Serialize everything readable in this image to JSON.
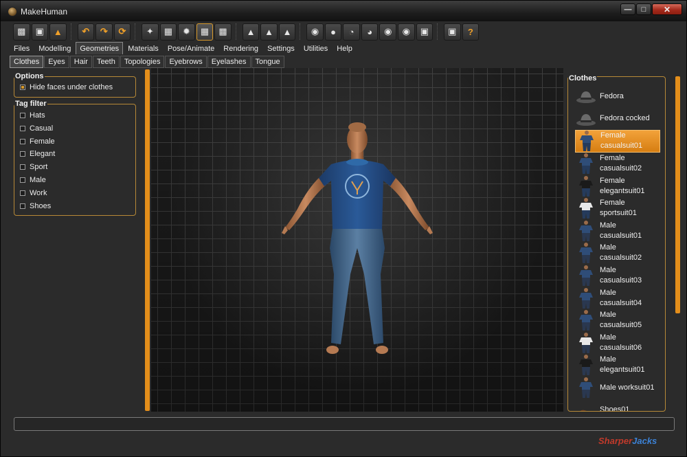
{
  "window": {
    "title": "MakeHuman",
    "minimize_icon": "minimize-icon",
    "maximize_icon": "maximize-icon",
    "close_icon": "close-icon"
  },
  "toolbar": {
    "groups": [
      [
        "file-icon",
        "save-icon",
        "export-icon"
      ],
      [
        "undo-icon",
        "redo-icon",
        "reset-icon"
      ],
      [
        "smooth-icon",
        "wireframe-icon",
        "pose-icon",
        "grid-icon",
        "checker-icon"
      ],
      [
        "front-view-icon",
        "side-view-icon",
        "top-view-icon"
      ],
      [
        "head-front-icon",
        "head-back-icon",
        "head-left-icon",
        "head-right-icon",
        "head-top-icon",
        "head-bottom-icon",
        "reset-camera-icon"
      ],
      [
        "screenshot-icon",
        "help-icon"
      ]
    ],
    "active": "grid-icon"
  },
  "tabs": [
    "Files",
    "Modelling",
    "Geometries",
    "Materials",
    "Pose/Animate",
    "Rendering",
    "Settings",
    "Utilities",
    "Help"
  ],
  "active_tab": "Geometries",
  "subtabs": [
    "Clothes",
    "Eyes",
    "Hair",
    "Teeth",
    "Topologies",
    "Eyebrows",
    "Eyelashes",
    "Tongue"
  ],
  "active_subtab": "Clothes",
  "options": {
    "title": "Options",
    "hide_faces": {
      "label": "Hide faces under clothes",
      "checked": true
    }
  },
  "tag_filter": {
    "title": "Tag filter",
    "tags": [
      "Hats",
      "Casual",
      "Female",
      "Elegant",
      "Sport",
      "Male",
      "Work",
      "Shoes"
    ]
  },
  "clothes": {
    "title": "Clothes",
    "items": [
      {
        "label": "Fedora",
        "icon": "fedora-hat-icon",
        "selected": false
      },
      {
        "label": "Fedora cocked",
        "icon": "fedora-cocked-icon",
        "selected": false
      },
      {
        "label": "Female casualsuit01",
        "icon": "female-casualsuit01-icon",
        "selected": true
      },
      {
        "label": "Female casualsuit02",
        "icon": "female-casualsuit02-icon",
        "selected": false
      },
      {
        "label": "Female elegantsuit01",
        "icon": "female-elegantsuit01-icon",
        "selected": false
      },
      {
        "label": "Female sportsuit01",
        "icon": "female-sportsuit01-icon",
        "selected": false
      },
      {
        "label": "Male casualsuit01",
        "icon": "male-casualsuit01-icon",
        "selected": false
      },
      {
        "label": "Male casualsuit02",
        "icon": "male-casualsuit02-icon",
        "selected": false
      },
      {
        "label": "Male casualsuit03",
        "icon": "male-casualsuit03-icon",
        "selected": false
      },
      {
        "label": "Male casualsuit04",
        "icon": "male-casualsuit04-icon",
        "selected": false
      },
      {
        "label": "Male casualsuit05",
        "icon": "male-casualsuit05-icon",
        "selected": false
      },
      {
        "label": "Male casualsuit06",
        "icon": "male-casualsuit06-icon",
        "selected": false
      },
      {
        "label": "Male elegantsuit01",
        "icon": "male-elegantsuit01-icon",
        "selected": false
      },
      {
        "label": "Male worksuit01",
        "icon": "male-worksuit01-icon",
        "selected": false
      },
      {
        "label": "Shoes01",
        "icon": "shoes01-icon",
        "selected": false
      }
    ]
  },
  "watermark": {
    "part1": "Sharper",
    "part2": "Jacks"
  },
  "colors": {
    "accent": "#e38e1b",
    "selection": "#e8921f",
    "frame": "#2b2b2b"
  }
}
